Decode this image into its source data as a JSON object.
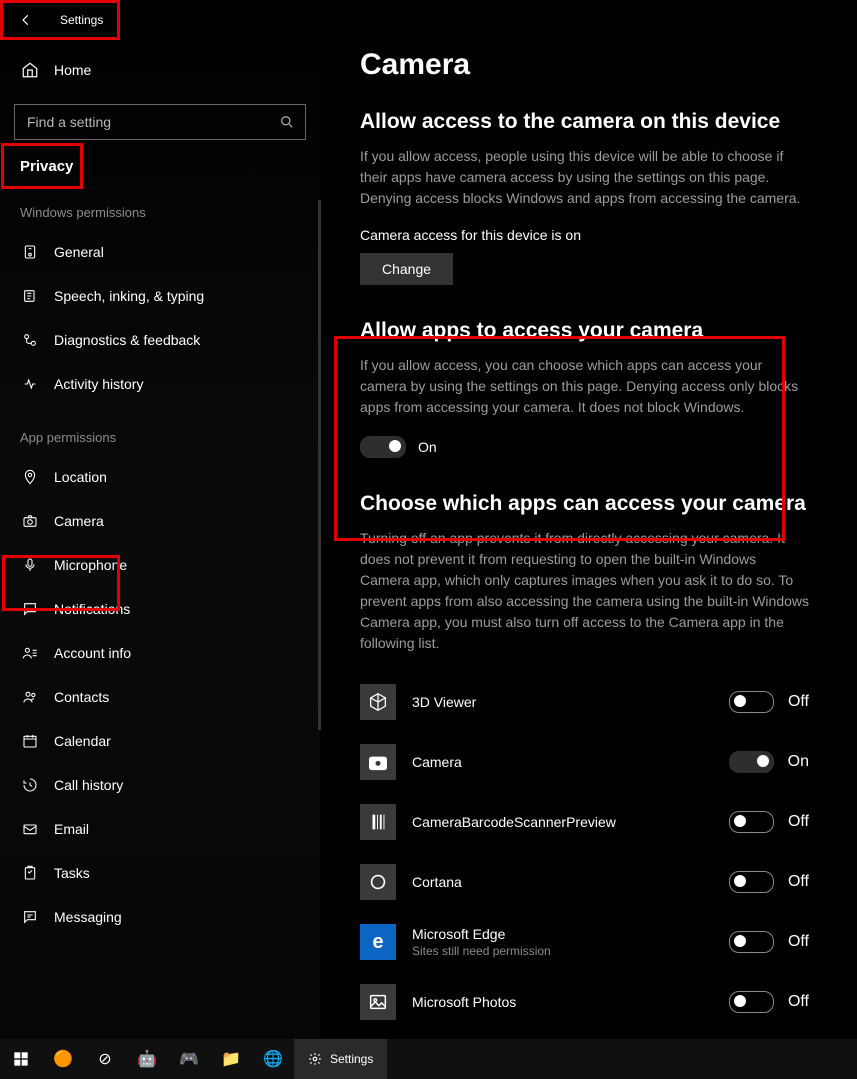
{
  "titlebar": {
    "title": "Settings"
  },
  "sidebar": {
    "home_label": "Home",
    "search_placeholder": "Find a setting",
    "category_label": "Privacy",
    "sections": [
      {
        "header": "Windows permissions",
        "items": [
          {
            "icon": "general-icon",
            "label": "General"
          },
          {
            "icon": "speech-icon",
            "label": "Speech, inking, & typing"
          },
          {
            "icon": "diagnostics-icon",
            "label": "Diagnostics & feedback"
          },
          {
            "icon": "activity-icon",
            "label": "Activity history"
          }
        ]
      },
      {
        "header": "App permissions",
        "items": [
          {
            "icon": "location-icon",
            "label": "Location"
          },
          {
            "icon": "camera-icon",
            "label": "Camera",
            "selected": true
          },
          {
            "icon": "microphone-icon",
            "label": "Microphone"
          },
          {
            "icon": "notifications-icon",
            "label": "Notifications"
          },
          {
            "icon": "account-icon",
            "label": "Account info"
          },
          {
            "icon": "contacts-icon",
            "label": "Contacts"
          },
          {
            "icon": "calendar-icon",
            "label": "Calendar"
          },
          {
            "icon": "callhistory-icon",
            "label": "Call history"
          },
          {
            "icon": "email-icon",
            "label": "Email"
          },
          {
            "icon": "tasks-icon",
            "label": "Tasks"
          },
          {
            "icon": "messaging-icon",
            "label": "Messaging"
          }
        ]
      }
    ]
  },
  "content": {
    "title": "Camera",
    "section1": {
      "heading": "Allow access to the camera on this device",
      "desc": "If you allow access, people using this device will be able to choose if their apps have camera access by using the settings on this page. Denying access blocks Windows and apps from accessing the camera.",
      "status": "Camera access for this device is on",
      "button": "Change"
    },
    "section2": {
      "heading": "Allow apps to access your camera",
      "desc": "If you allow access, you can choose which apps can access your camera by using the settings on this page. Denying access only blocks apps from accessing your camera. It does not block Windows.",
      "toggle_state": true,
      "toggle_label": "On"
    },
    "section3": {
      "heading": "Choose which apps can access your camera",
      "desc": "Turning off an app prevents it from directly accessing your camera. It does not prevent it from requesting to open the built-in Windows Camera app, which only captures images when you ask it to do so. To prevent apps from also accessing the camera using the built-in Windows Camera app, you must also turn off access to the Camera app in the following list.",
      "apps": [
        {
          "name": "3D Viewer",
          "state": false,
          "label": "Off",
          "icon_bg": "#3a3a3a"
        },
        {
          "name": "Camera",
          "state": true,
          "label": "On",
          "icon_bg": "#3a3a3a"
        },
        {
          "name": "CameraBarcodeScannerPreview",
          "state": false,
          "label": "Off",
          "icon_bg": "#3a3a3a"
        },
        {
          "name": "Cortana",
          "state": false,
          "label": "Off",
          "icon_bg": "#3a3a3a"
        },
        {
          "name": "Microsoft Edge",
          "sub": "Sites still need permission",
          "state": false,
          "label": "Off",
          "icon_bg": "#0a66c2"
        },
        {
          "name": "Microsoft Photos",
          "state": false,
          "label": "Off",
          "icon_bg": "#3a3a3a"
        }
      ]
    }
  },
  "taskbar": {
    "active_app": "Settings"
  }
}
